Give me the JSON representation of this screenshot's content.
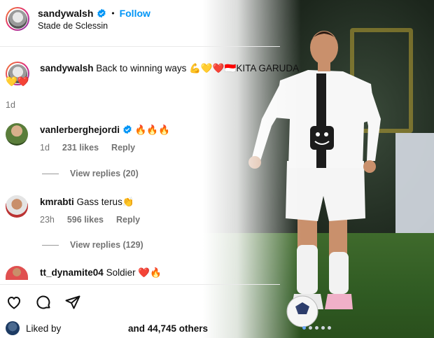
{
  "post": {
    "username": "sandywalsh",
    "follow_label": "Follow",
    "separator": "•",
    "location": "Stade de Sclessin"
  },
  "caption": {
    "username": "sandywalsh",
    "text_line1": "Back to winning ways 💪💛❤️🇮🇩KITA GARUDA",
    "text_line2": "💛❤️",
    "time": "1d"
  },
  "comments": [
    {
      "username": "vanlerberghejordi",
      "text": "🔥🔥🔥",
      "time": "1d",
      "likes": "231 likes",
      "reply_label": "Reply",
      "view_replies": "View replies (20)"
    },
    {
      "username": "kmrabti",
      "text": "Gass terus👏",
      "time": "23h",
      "likes": "596 likes",
      "reply_label": "Reply",
      "view_replies": "View replies (129)"
    },
    {
      "username": "tt_dynamite04",
      "text": "Soldier ❤️🔥"
    }
  ],
  "footer": {
    "liked_by_label": "Liked by",
    "and_others": "and 44,745 others"
  },
  "icons": {
    "like": "heart-icon",
    "comment": "comment-icon",
    "share": "send-icon",
    "verified": "verified-badge-icon"
  },
  "colors": {
    "accent": "#0095f6",
    "verified": "#0095f6",
    "muted": "#737373"
  }
}
